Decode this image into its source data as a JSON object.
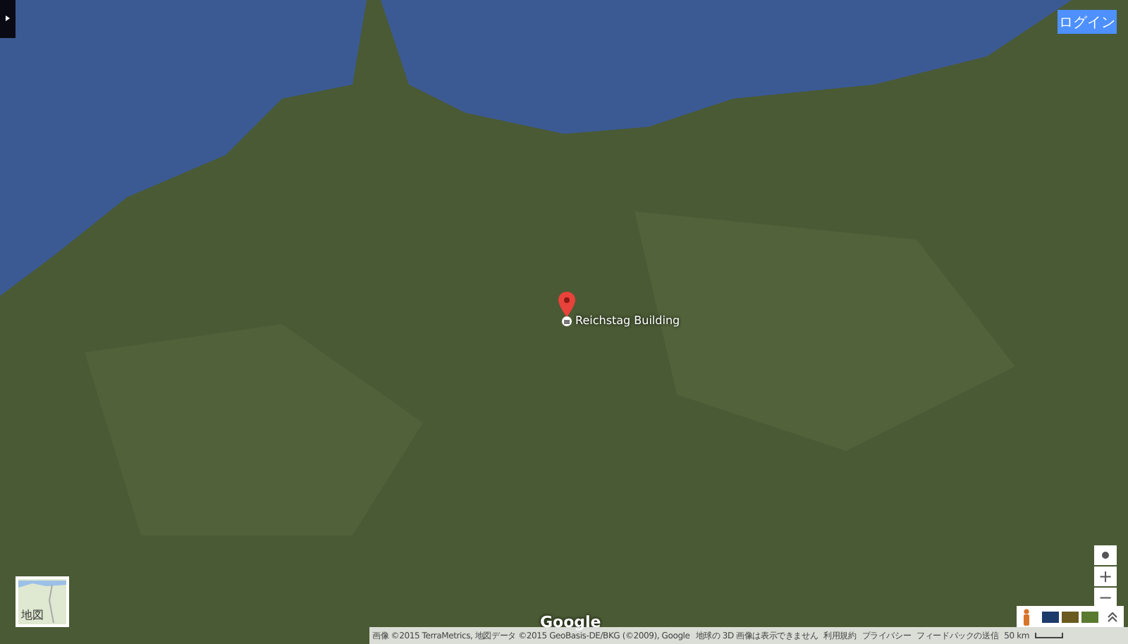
{
  "header": {
    "login_button": "ログイン"
  },
  "marker": {
    "label": "Reichstag Building"
  },
  "minimap": {
    "label": "地図"
  },
  "logo": "Google",
  "attribution": {
    "imagery": "画像 ©2015 TerraMetrics, 地図データ ©2015 GeoBasis-DE/BKG (©2009), Google",
    "notice": "地球の 3D 画像は表示できません",
    "links": [
      "利用規約",
      "プライバシー",
      "フィードバックの送信"
    ],
    "scale": "50 km"
  },
  "zoom_controls": {
    "zoom_in": "+",
    "zoom_out": "−"
  }
}
